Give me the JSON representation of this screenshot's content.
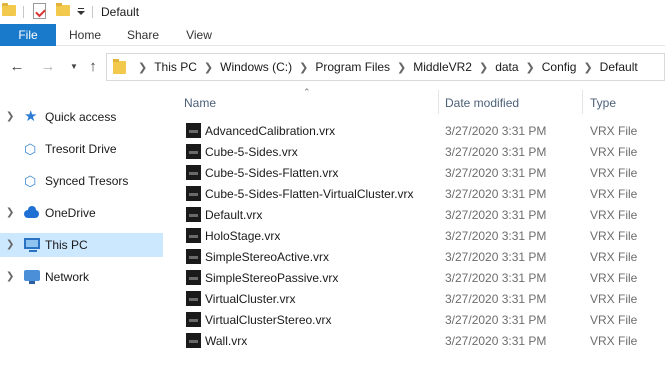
{
  "titlebar": {
    "title": "Default",
    "quick_access_icons": [
      "folder-icon",
      "properties-icon",
      "new-folder-icon",
      "customize-toolbar-icon"
    ]
  },
  "ribbon": {
    "tabs": [
      {
        "label": "File",
        "active": true
      },
      {
        "label": "Home"
      },
      {
        "label": "Share"
      },
      {
        "label": "View"
      }
    ],
    "colors": {
      "file_tab": "#1979ca"
    }
  },
  "address": {
    "breadcrumbs": [
      "This PC",
      "Windows (C:)",
      "Program Files",
      "MiddleVR2",
      "data",
      "Config",
      "Default"
    ]
  },
  "nav": {
    "items": [
      {
        "label": "Quick access",
        "icon": "star-icon",
        "expandable": true
      },
      {
        "label": "Tresorit Drive",
        "icon": "tresorit-icon",
        "expandable": false
      },
      {
        "label": "Synced Tresors",
        "icon": "tresorit-icon",
        "expandable": false
      },
      {
        "label": "OneDrive",
        "icon": "cloud-icon",
        "expandable": true
      },
      {
        "label": "This PC",
        "icon": "computer-icon",
        "expandable": true,
        "selected": true
      },
      {
        "label": "Network",
        "icon": "network-icon",
        "expandable": true
      }
    ],
    "selected_color": "#cce8ff"
  },
  "files": {
    "columns": [
      "Name",
      "Date modified",
      "Type"
    ],
    "rows": [
      {
        "name": "AdvancedCalibration.vrx",
        "date": "3/27/2020 3:31 PM",
        "type": "VRX File"
      },
      {
        "name": "Cube-5-Sides.vrx",
        "date": "3/27/2020 3:31 PM",
        "type": "VRX File"
      },
      {
        "name": "Cube-5-Sides-Flatten.vrx",
        "date": "3/27/2020 3:31 PM",
        "type": "VRX File"
      },
      {
        "name": "Cube-5-Sides-Flatten-VirtualCluster.vrx",
        "date": "3/27/2020 3:31 PM",
        "type": "VRX File"
      },
      {
        "name": "Default.vrx",
        "date": "3/27/2020 3:31 PM",
        "type": "VRX File"
      },
      {
        "name": "HoloStage.vrx",
        "date": "3/27/2020 3:31 PM",
        "type": "VRX File"
      },
      {
        "name": "SimpleStereoActive.vrx",
        "date": "3/27/2020 3:31 PM",
        "type": "VRX File"
      },
      {
        "name": "SimpleStereoPassive.vrx",
        "date": "3/27/2020 3:31 PM",
        "type": "VRX File"
      },
      {
        "name": "VirtualCluster.vrx",
        "date": "3/27/2020 3:31 PM",
        "type": "VRX File"
      },
      {
        "name": "VirtualClusterStereo.vrx",
        "date": "3/27/2020 3:31 PM",
        "type": "VRX File"
      },
      {
        "name": "Wall.vrx",
        "date": "3/27/2020 3:31 PM",
        "type": "VRX File"
      }
    ]
  }
}
